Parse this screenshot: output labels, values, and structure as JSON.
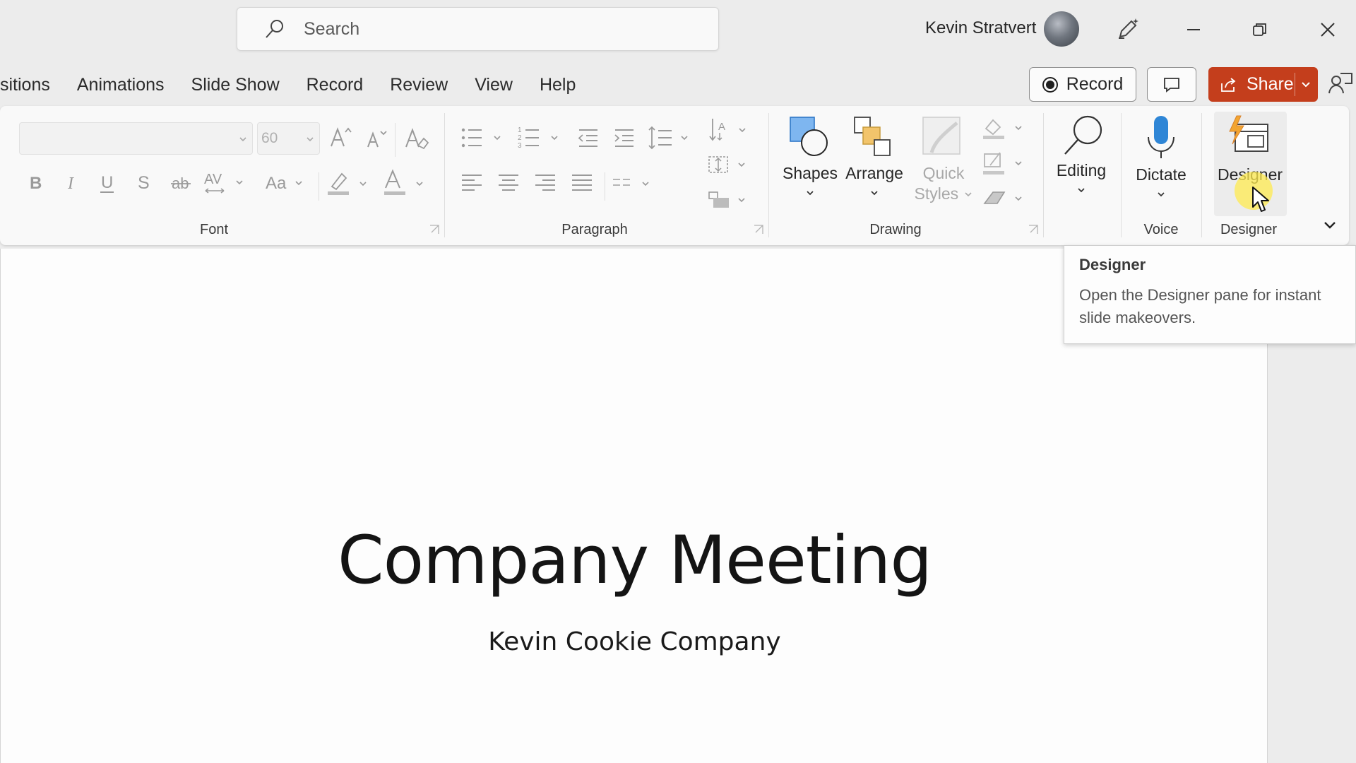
{
  "titlebar": {
    "search_placeholder": "Search",
    "user_name": "Kevin Stratvert"
  },
  "tabs": [
    "sitions",
    "Animations",
    "Slide Show",
    "Record",
    "Review",
    "View",
    "Help"
  ],
  "header_buttons": {
    "record": "Record",
    "share": "Share",
    "share_color": "#c43e1c"
  },
  "ribbon": {
    "font": {
      "name": "",
      "size": "60",
      "group_label": "Font"
    },
    "paragraph": {
      "group_label": "Paragraph"
    },
    "drawing": {
      "group_label": "Drawing",
      "shapes": "Shapes",
      "arrange": "Arrange",
      "quick_styles_1": "Quick",
      "quick_styles_2": "Styles"
    },
    "editing": {
      "label": "Editing"
    },
    "voice": {
      "dictate": "Dictate",
      "group_label": "Voice"
    },
    "designer": {
      "label": "Designer",
      "group_label": "Designer"
    }
  },
  "tooltip": {
    "title": "Designer",
    "body": "Open the Designer pane for instant slide makeovers."
  },
  "slide": {
    "title": "Company Meeting",
    "subtitle": "Kevin Cookie Company"
  }
}
